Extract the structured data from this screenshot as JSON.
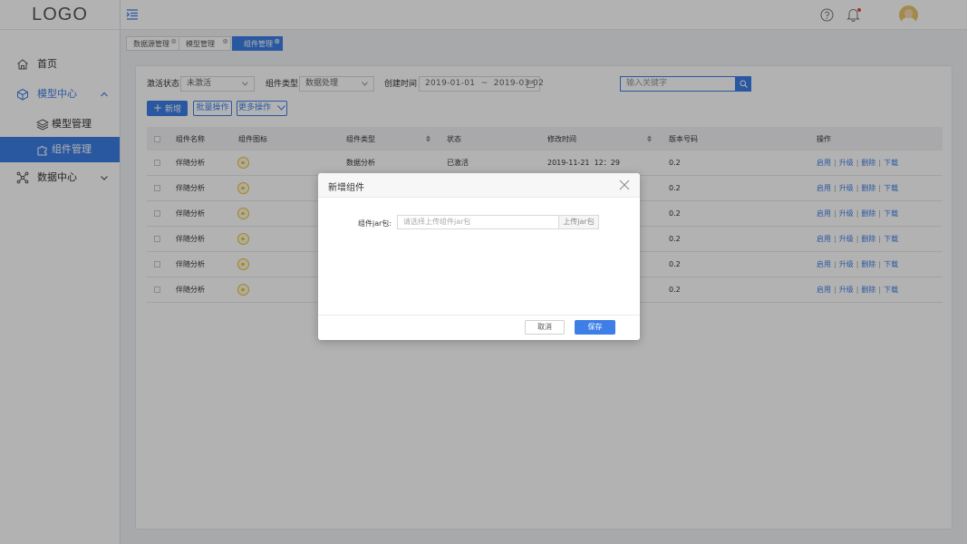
{
  "logo": "LOGO",
  "sidebar": {
    "items": [
      {
        "label": "首页",
        "icon": "home-icon"
      },
      {
        "label": "模型中心",
        "icon": "cube-icon",
        "expanded": true,
        "children": [
          {
            "label": "模型管理",
            "icon": "layers-icon"
          },
          {
            "label": "组件管理",
            "icon": "puzzle-icon",
            "active": true
          }
        ]
      },
      {
        "label": "数据中心",
        "icon": "network-icon",
        "expanded": false
      }
    ]
  },
  "header": {
    "menu_icon": "menu-fold-icon",
    "help_icon": "help-icon",
    "notification_icon": "bell-icon",
    "avatar_icon": "avatar-icon"
  },
  "tabs": [
    {
      "label": "数据源管理"
    },
    {
      "label": "模型管理"
    },
    {
      "label": "组件管理",
      "active": true
    }
  ],
  "filters": {
    "activation_label": "激活状态",
    "activation_value": "未激活",
    "type_label": "组件类型",
    "type_value": "数据处理",
    "created_label": "创建时间",
    "date_range": "2019-01-01  ~  2019-03-02",
    "search_placeholder": "输入关键字"
  },
  "toolbar": {
    "add_label": "新增",
    "batch_label": "批量操作",
    "more_label": "更多操作"
  },
  "table": {
    "columns": [
      "组件名称",
      "组件图标",
      "组件类型",
      "状态",
      "修改时间",
      "版本号码",
      "操作"
    ],
    "rows": [
      {
        "name": "伴随分析",
        "type": "数据分析",
        "status": "已激活",
        "modified": "2019-11-21  12：29",
        "version": "0.2"
      },
      {
        "name": "伴随分析",
        "type": "",
        "status": "",
        "modified": "",
        "version": "0.2"
      },
      {
        "name": "伴随分析",
        "type": "",
        "status": "",
        "modified": "",
        "version": "0.2"
      },
      {
        "name": "伴随分析",
        "type": "",
        "status": "",
        "modified": "",
        "version": "0.2"
      },
      {
        "name": "伴随分析",
        "type": "",
        "status": "",
        "modified": "",
        "version": "0.2"
      },
      {
        "name": "伴随分析",
        "type": "",
        "status": "",
        "modified": "",
        "version": "0.2"
      }
    ],
    "actions": [
      "启用",
      "升级",
      "删除",
      "下载"
    ]
  },
  "modal": {
    "title": "新增组件",
    "field_label": "组件jar包:",
    "upload_placeholder": "请选择上传组件jar包",
    "upload_button": "上传jar包",
    "cancel_label": "取消",
    "save_label": "保存"
  },
  "colors": {
    "primary": "#3d7fe6",
    "component_icon": "#e6c13a",
    "notification_dot": "#e74c3c"
  }
}
